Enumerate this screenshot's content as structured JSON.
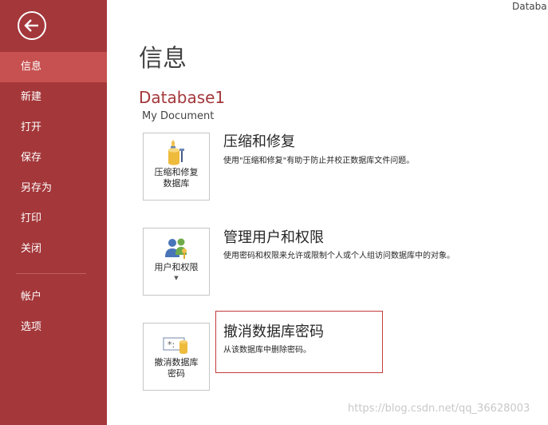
{
  "window": {
    "title_fragment": "Databa"
  },
  "sidebar": {
    "back_icon": "back-arrow-icon",
    "items": [
      {
        "label": "信息",
        "active": true
      },
      {
        "label": "新建"
      },
      {
        "label": "打开"
      },
      {
        "label": "保存"
      },
      {
        "label": "另存为"
      },
      {
        "label": "打印"
      },
      {
        "label": "关闭"
      },
      {
        "label": "帐户"
      },
      {
        "label": "选项"
      }
    ]
  },
  "main": {
    "page_title": "信息",
    "database_name": "Database1",
    "database_location": "My Document",
    "sections": [
      {
        "tile_label_line1": "压缩和修复",
        "tile_label_line2": "数据库",
        "tile_icon": "compact-repair-icon",
        "title": "压缩和修复",
        "description": "使用\"压缩和修复\"有助于防止并校正数据库文件问题。"
      },
      {
        "tile_label_line1": "用户和权限",
        "tile_label_line2": "",
        "tile_icon": "users-permissions-icon",
        "has_dropdown": true,
        "title": "管理用户和权限",
        "description": "使用密码和权限来允许或限制个人或个人组访问数据库中的对象。"
      },
      {
        "tile_label_line1": "撤消数据库",
        "tile_label_line2": "密码",
        "tile_icon": "remove-password-icon",
        "title": "撤消数据库密码",
        "description": "从该数据库中删除密码。",
        "highlighted": true
      }
    ]
  },
  "watermark": "https://blog.csdn.net/qq_36628003",
  "colors": {
    "sidebar": "#a4373a",
    "sidebar_active": "#c75050",
    "accent": "#a4373a",
    "highlight_border": "#c43b3b"
  }
}
